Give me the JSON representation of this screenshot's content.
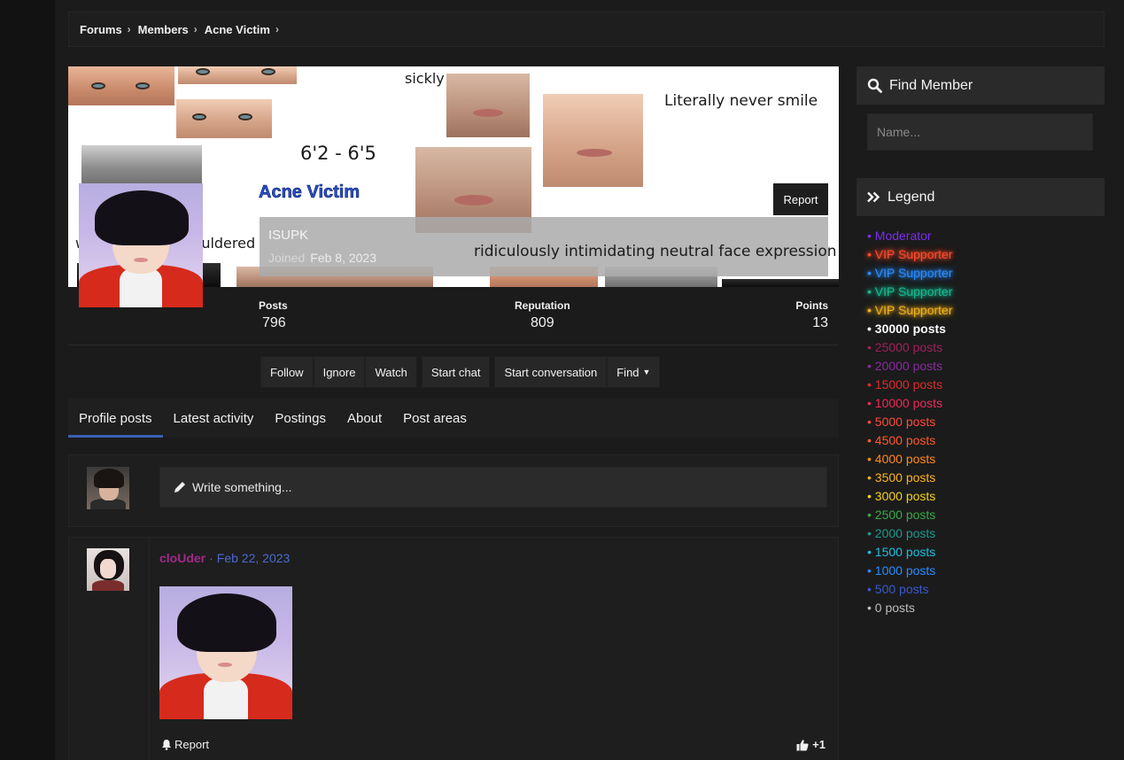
{
  "breadcrumb": [
    {
      "label": "Forums"
    },
    {
      "label": "Members"
    },
    {
      "label": "Acne Victim"
    }
  ],
  "banner": {
    "texts": {
      "sickly": "sickly",
      "never_smile": "Literally never smile",
      "height": "6'2 - 6'5",
      "broad": "weirdly broad shouldered",
      "intimidating": "ridiculously intimidating neutral face expression"
    }
  },
  "profile": {
    "name": "Acne Victim",
    "title": "ISUPK",
    "joined_label": "Joined",
    "joined_date": "Feb 8, 2023",
    "report_label": "Report"
  },
  "stats": {
    "posts": {
      "label": "Posts",
      "value": "796"
    },
    "reputation": {
      "label": "Reputation",
      "value": "809"
    },
    "points": {
      "label": "Points",
      "value": "13"
    }
  },
  "actions": {
    "follow": "Follow",
    "ignore": "Ignore",
    "watch": "Watch",
    "start_chat": "Start chat",
    "start_conversation": "Start conversation",
    "find": "Find"
  },
  "tabs": [
    "Profile posts",
    "Latest activity",
    "Postings",
    "About",
    "Post areas"
  ],
  "write": {
    "placeholder": "Write something..."
  },
  "comment": {
    "user": "cloUder",
    "separator": "·",
    "date": "Feb 22, 2023",
    "report_label": "Report",
    "likes": "+1"
  },
  "sidebar": {
    "find_member_title": "Find Member",
    "name_placeholder": "Name...",
    "legend_title": "Legend",
    "legend": [
      {
        "label": "• Moderator",
        "color": "#7c2cf0",
        "glow": false,
        "bold": false
      },
      {
        "label": "• VIP Supporter",
        "color": "#ff4a2a",
        "glow": true,
        "bold": false
      },
      {
        "label": "• VIP Supporter",
        "color": "#2a8cff",
        "glow": true,
        "bold": false
      },
      {
        "label": "• VIP Supporter",
        "color": "#17b890",
        "glow": true,
        "bold": false
      },
      {
        "label": "• VIP Supporter",
        "color": "#f2b21a",
        "glow": true,
        "bold": false
      },
      {
        "label": "• 30000 posts",
        "color": "#ffffff",
        "glow": false,
        "bold": true
      },
      {
        "label": "• 25000 posts",
        "color": "#a0205a",
        "glow": false,
        "bold": false
      },
      {
        "label": "• 20000 posts",
        "color": "#8a2aa0",
        "glow": false,
        "bold": false
      },
      {
        "label": "• 15000 posts",
        "color": "#e02a2a",
        "glow": false,
        "bold": false
      },
      {
        "label": "• 10000 posts",
        "color": "#ee2a5a",
        "glow": false,
        "bold": false
      },
      {
        "label": "• 5000 posts",
        "color": "#ff4a3a",
        "glow": false,
        "bold": false
      },
      {
        "label": "• 4500 posts",
        "color": "#ff5a2a",
        "glow": false,
        "bold": false
      },
      {
        "label": "• 4000 posts",
        "color": "#ff8a1a",
        "glow": false,
        "bold": false
      },
      {
        "label": "• 3500 posts",
        "color": "#ffb21a",
        "glow": false,
        "bold": false
      },
      {
        "label": "• 3000 posts",
        "color": "#f5d21a",
        "glow": false,
        "bold": false
      },
      {
        "label": "• 2500 posts",
        "color": "#3aa84a",
        "glow": false,
        "bold": false
      },
      {
        "label": "• 2000 posts",
        "color": "#1a9a8a",
        "glow": false,
        "bold": false
      },
      {
        "label": "• 1500 posts",
        "color": "#1ac0e0",
        "glow": false,
        "bold": false
      },
      {
        "label": "• 1000 posts",
        "color": "#2a8cff",
        "glow": false,
        "bold": false
      },
      {
        "label": "• 500 posts",
        "color": "#3a5ad0",
        "glow": false,
        "bold": false
      },
      {
        "label": "• 0 posts",
        "color": "#bdbdbd",
        "glow": false,
        "bold": false
      }
    ]
  }
}
